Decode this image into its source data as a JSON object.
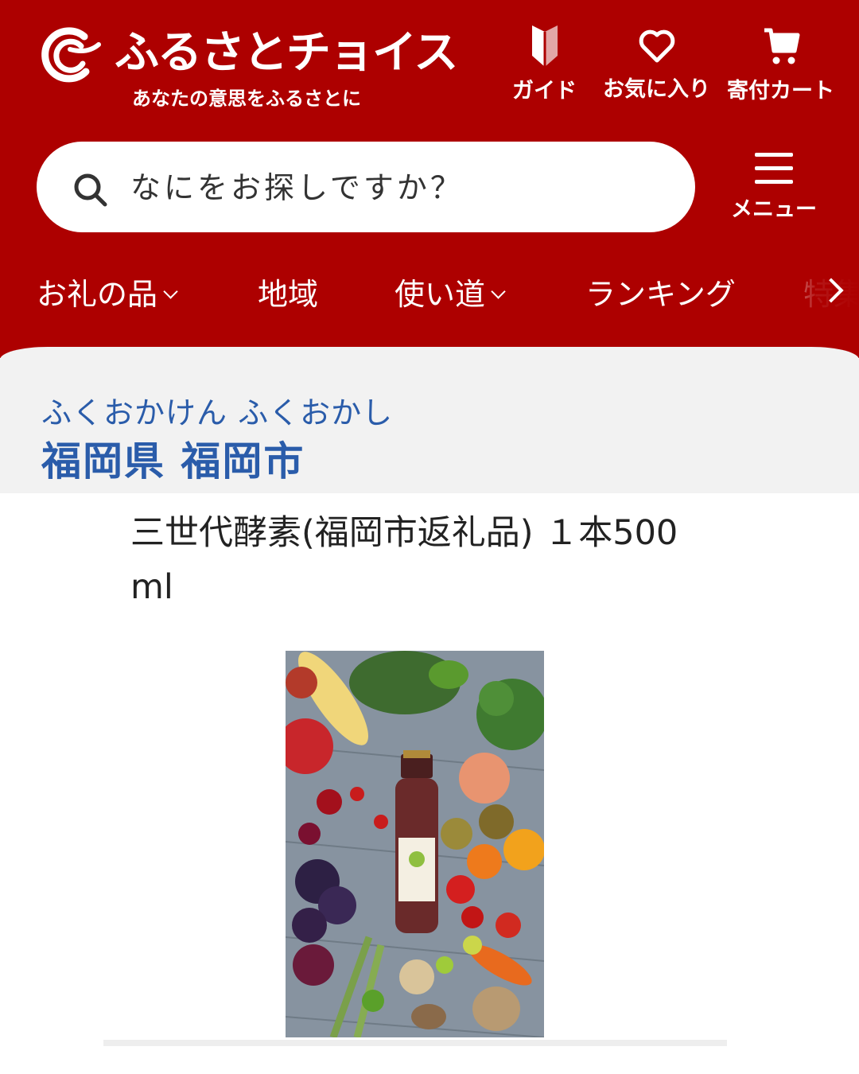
{
  "header": {
    "brand": "ふるさとチョイス",
    "tagline": "あなたの意思をふるさとに",
    "guide_label": "ガイド",
    "favorites_label": "お気に入り",
    "cart_label": "寄付カート",
    "menu_label": "メニュー",
    "brand_color": "#ad0000"
  },
  "search": {
    "placeholder": "なにをお探しですか？"
  },
  "nav": {
    "items": [
      {
        "label": "お礼の品",
        "has_dropdown": true
      },
      {
        "label": "地域",
        "has_dropdown": false
      },
      {
        "label": "使い道",
        "has_dropdown": true
      },
      {
        "label": "ランキング",
        "has_dropdown": false
      },
      {
        "label": "特集",
        "has_dropdown": false
      }
    ]
  },
  "city": {
    "kana": "ふくおかけん ふくおかし",
    "name": "福岡県 福岡市",
    "text_color": "#2a5caa"
  },
  "product": {
    "title": "三世代酵素(福岡市返礼品) １本500ml",
    "image_icon": "product-photo-enzyme-bottle-with-vegetables"
  }
}
